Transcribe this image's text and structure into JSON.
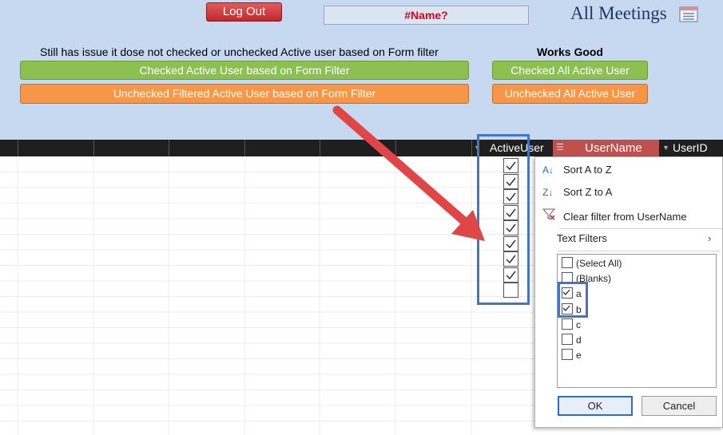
{
  "header": {
    "logout_label": "Log Out",
    "name_error": "#Name?",
    "form_title": "All Meetings",
    "issue_note": "Still has issue it dose not checked or unchecked Active user based on Form filter",
    "works_note": "Works Good",
    "btn_checked_filter": "Checked Active User based on Form Filter",
    "btn_unchecked_filter": "Unchecked Filtered Active User based on Form Filter",
    "btn_checked_all": "Checked All Active User",
    "btn_unchecked_all": "Unchecked All Active User"
  },
  "columns": {
    "active_user": "ActiveUser",
    "user_name": "UserName",
    "user_id": "UserID"
  },
  "active_user_rows": [
    true,
    true,
    true,
    true,
    true,
    true,
    true,
    true,
    false
  ],
  "filter_menu": {
    "sort_az": "Sort A to Z",
    "sort_za": "Sort Z to A",
    "clear_filter": "Clear filter from UserName",
    "text_filters": "Text Filters",
    "list": [
      {
        "label": "(Select All)",
        "checked": false
      },
      {
        "label": "(Blanks)",
        "checked": false
      },
      {
        "label": "a",
        "checked": true
      },
      {
        "label": "b",
        "checked": true
      },
      {
        "label": "c",
        "checked": false
      },
      {
        "label": "d",
        "checked": false
      },
      {
        "label": "e",
        "checked": false
      }
    ],
    "ok_label": "OK",
    "cancel_label": "Cancel"
  },
  "colors": {
    "header_bg": "#c6d9f1",
    "green_button": "#8cc152",
    "orange_button": "#f79646",
    "username_header": "#c0504d",
    "highlight_box": "#4673c4",
    "arrow": "#e04646"
  }
}
